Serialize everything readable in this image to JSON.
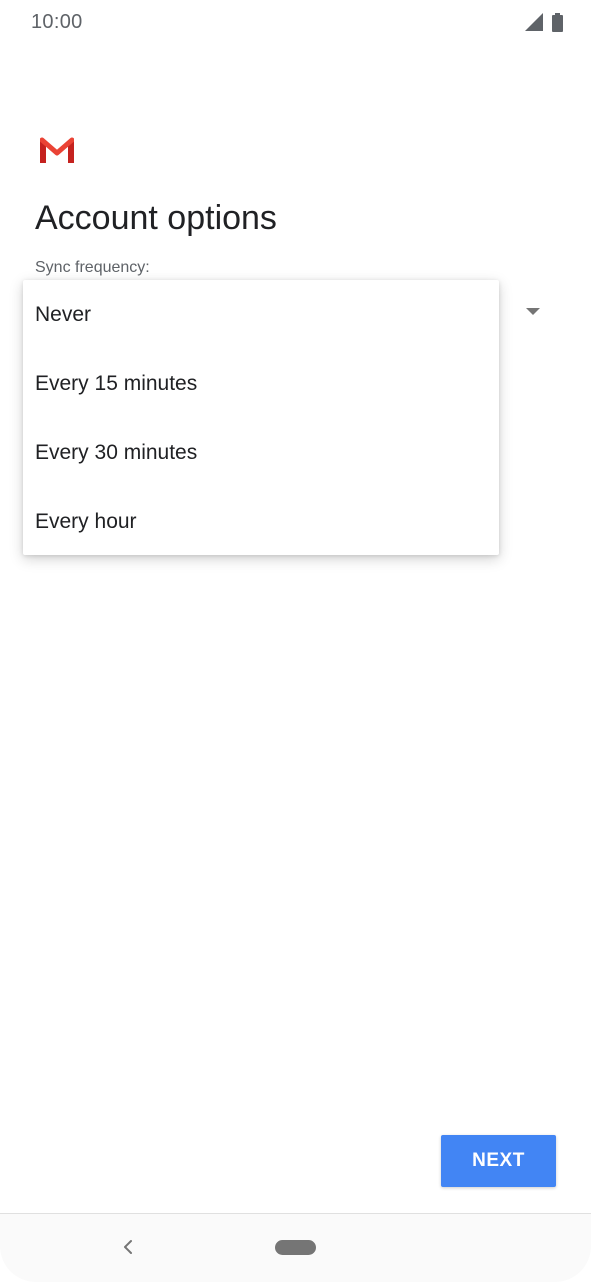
{
  "status_bar": {
    "time": "10:00",
    "icons": [
      "signal-icon",
      "battery-icon"
    ]
  },
  "header": {
    "logo": "gmail-logo",
    "title": "Account options"
  },
  "sync": {
    "label": "Sync frequency:",
    "options": [
      "Never",
      "Every 15 minutes",
      "Every 30 minutes",
      "Every hour"
    ]
  },
  "footer": {
    "next_label": "NEXT"
  },
  "nav": {
    "icons": [
      "back-icon",
      "home-pill"
    ]
  },
  "colors": {
    "accent": "#4285f4",
    "gmail_red": "#ea4335",
    "text_primary": "#202124",
    "text_secondary": "#5f6368"
  }
}
